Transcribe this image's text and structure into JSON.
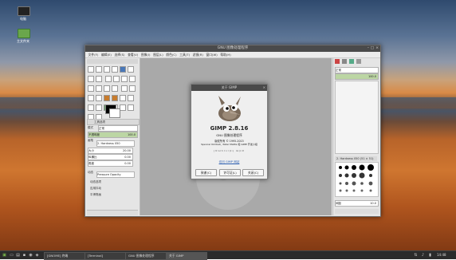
{
  "desktop": {
    "icons": [
      {
        "label": "电脑",
        "icon": "computer-icon"
      },
      {
        "label": "主文件夹",
        "icon": "home-folder-icon"
      }
    ]
  },
  "gimp": {
    "window_title": "GNU 图像处理程序",
    "menus": [
      "文件(F)",
      "编辑(E)",
      "选择(S)",
      "查看(V)",
      "图像(I)",
      "图层(L)",
      "颜色(C)",
      "工具(T)",
      "滤镜(R)",
      "窗口(W)",
      "帮助(H)"
    ],
    "tool_options": {
      "header": "工具选项",
      "paint_label": "模式",
      "mode_value": "正常",
      "opacity_label": "不透明度",
      "opacity_value": "100.0",
      "brush_label": "画笔",
      "brush_value": "2. Hardness 050",
      "size_label": "大小",
      "size_value": "20.00",
      "ratio_label": "纵横比",
      "ratio_value": "0.00",
      "angle_label": "角度",
      "angle_value": "0.00",
      "dynamics_label": "动态",
      "dynamics_value": "Pressure Opacity",
      "dynamics_options": "动态选项",
      "apply_jitter": "应用抖动",
      "smooth_stroke": "平滑笔画"
    },
    "dock": {
      "mode_value": "正常",
      "opacity_value": "100.0",
      "brushes_header": "2. Hardness 050 (51 × 51)",
      "spacing_label": "间距",
      "spacing_value": "10.0"
    }
  },
  "about": {
    "title": "关于 GIMP",
    "version": "GIMP 2.8.16",
    "subtitle": "GNU 图像处理程序",
    "copyright": "版权所有 © 1995-2015",
    "credits": "Spencer Kimball、Peter Mattis 和 GIMP 开发小组",
    "animated_text": "ȷɐɯsɔɹıpʇ ɯpɐ",
    "link": "访问 GIMP 网站",
    "buttons": {
      "credits": "致谢(C)",
      "license": "许可证(L)",
      "close": "关闭(C)"
    }
  },
  "taskbar": {
    "tasks": [
      "[GNOME] 终端",
      "[Terminal]",
      "GNU 图像处理程序",
      "关于 GIMP"
    ],
    "clock": "14:48"
  },
  "colors": {
    "window_title_bg": "#4a4a4a",
    "taskbar_bg": "#2b2b2b",
    "canvas_bg": "#a9a9a9",
    "highlight": "#bcd6a4"
  }
}
